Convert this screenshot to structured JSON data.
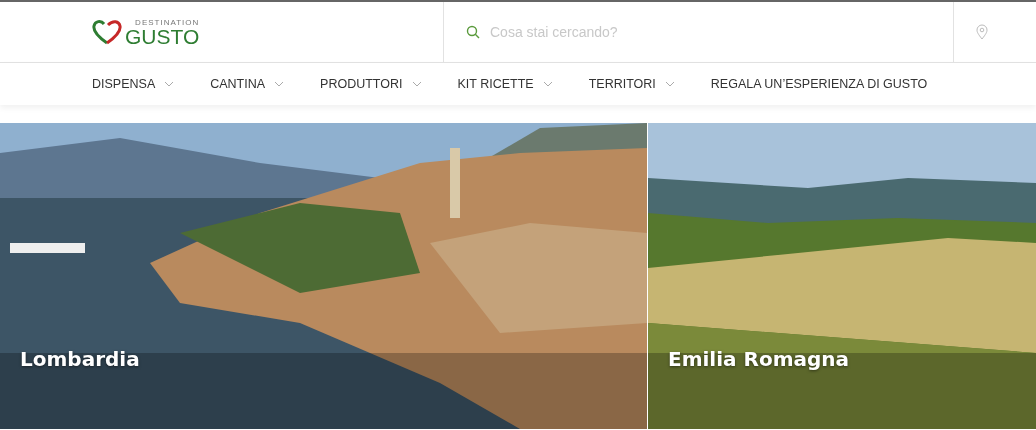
{
  "logo": {
    "tagline": "DESTINATION",
    "name": "GUSTO"
  },
  "search": {
    "placeholder": "Cosa stai cercando?"
  },
  "nav": [
    {
      "label": "DISPENSA",
      "dropdown": true
    },
    {
      "label": "CANTINA",
      "dropdown": true
    },
    {
      "label": "PRODUTTORI",
      "dropdown": true
    },
    {
      "label": "KIT RICETTE",
      "dropdown": true
    },
    {
      "label": "TERRITORI",
      "dropdown": true
    },
    {
      "label": "REGALA UN’ESPERIENZA DI GUSTO",
      "dropdown": false
    }
  ],
  "regions": [
    {
      "name": "Lombardia",
      "kind": "lake"
    },
    {
      "name": "Emilia Romagna",
      "kind": "hills"
    }
  ]
}
